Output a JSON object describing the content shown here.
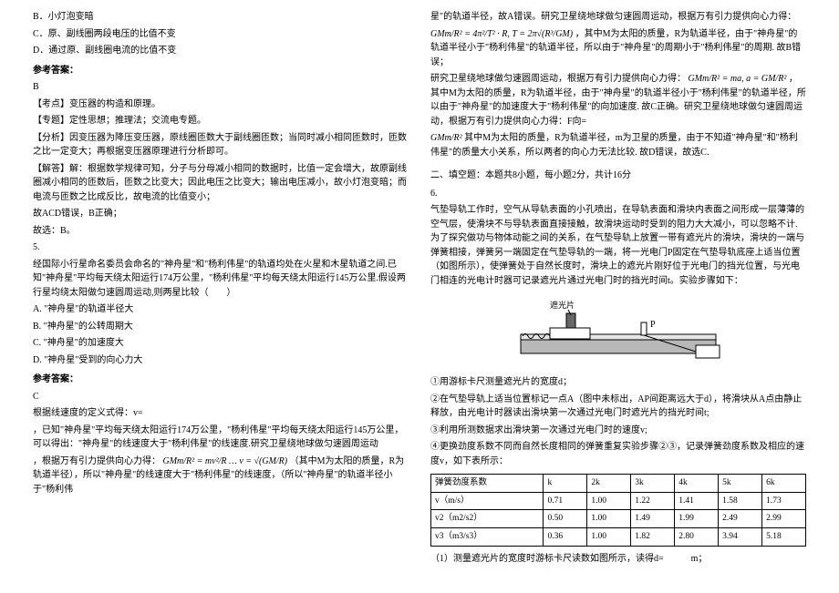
{
  "left": {
    "optB": "B．小灯泡变暗",
    "optC": "C．原、副线圈两段电压的比值不变",
    "optD": "D．通过原、副线圈电流的比值不变",
    "ansHead": "参考答案：",
    "ans": "B",
    "kd": "【考点】变压器的构造和原理。",
    "zt": "【专题】定性思想；推理法；交流电专题。",
    "fx": "【分析】因变压器为降压变压器，原线圈匝数大于副线圈匝数；当同时减小相同匝数时，匝数之比一定变大；再根据变压器原理进行分析即可。",
    "jdHead": "【解答】解：根据数学规律可知，分子与分母减小相同的数据时，比值一定会增大，故原副线圈减小相同的匝数后，匝数之比变大；因此电压之比变大；输出电压减小，故小灯泡变暗；而电流与匝数之比成反比，故电流的比值变小；",
    "jdRes": "故ACD错误，B正确；",
    "jdSel": "故选：B。",
    "q5num": "5.",
    "q5p1": "经国际小行星命名委员会命名的\"神舟星\"和\"杨利伟星\"的轨道均处在火星和木星轨道之间.已知\"神舟星\"平均每天绕太阳运行174万公里，\"杨利伟星\"平均每天绕太阳运行145万公里.假设两行星均绕太阳做匀速圆周运动,则两星比较（　　）",
    "q5A": "A. \"神舟星\"的轨道半径大",
    "q5B": "B. \"神舟星\"的公转周期大",
    "q5C": "C. \"神舟星\"的加速度大",
    "q5D": "D. \"神舟星\"受到的向心力大",
    "q5ansHead": "参考答案：",
    "q5ans": "C",
    "q5exp1": "根据线速度的定义式得：v=",
    "q5exp2": "，已知\"神舟星\"平均每天绕太阳运行174万公里，\"杨利伟星\"平均每天绕太阳运行145万公里，可以得出：\"神舟星\"的线速度大于\"杨利伟星\"的线速度.研究卫星绕地球做匀速圆周运动",
    "q5exp3": "，根据万有引力提供向心力得：",
    "q5exp4": "（其中M为太阳的质量，R为轨道半径），所以\"神舟星\"的线速度大于\"杨利伟星\"的线速度，（所以\"神舟星\"的轨道半径小于\"杨利伟"
  },
  "right": {
    "p1": "星\"的轨道半径，故A错误。研究卫星绕地球做匀速圆周运动，根据万有引力提供向心力得：",
    "p2": "，其中M为太阳的质量，R为轨道半径，由于\"神舟星\"的轨道半径小于\"杨利伟星\"的轨道半径，所以由于\"神舟星\"的周期小于\"杨利伟星\"的周期. 故B错误；",
    "p3": "研究卫星绕地球做匀速圆周运动，根据万有引力提供向心力得：",
    "p3b": "，其中M为太阳的质量，R为轨道半径，由于\"神舟星\"的轨道半径小于\"杨利伟星\"的轨道半径，所以由于\"神舟星\"的加速度大于\"杨利伟星\"的向加速度. 故C正确。研究卫星绕地球做匀速圆周运动，根据万有引力提供向心力得：F向=",
    "p4": "其中M为太阳的质量，R为轨道半径，m为卫星的质量，由于不知道\"神舟星\"和\"杨利伟星\"的质量大小关系，所以两者的向心力无法比较. 故D错误，故选C.",
    "section2": "二、填空题：本题共8小题，每小题2分，共计16分",
    "q6num": "6.",
    "q6text": "气垫导轨工作时，空气从导轨表面的小孔喷出，在导轨表面和滑块内表面之间形成一层薄薄的空气层，使滑块不与导轨表面直接接触，故滑块运动时受到的阻力大大减小，可以忽略不计.为了探究做功与物体动能之间的关系，在气垫导轨上放置一带有遮光片的滑块，滑块的一端与弹簧相接，弹簧另一端固定在气垫导轨的一端，将一光电门P固定在气垫导轨底座上适当位置（如图所示），使弹簧处于自然长度时，滑块上的遮光片刚好位于光电门的挡光位置，与光电门相连的光电计时器可记录遮光片通过光电门时的挡光时间t。实验步骤如下：",
    "diagLabel1": "遮光片",
    "diagLabelP": "P",
    "step1": "①用游标卡尺测量遮光片的宽度d；",
    "step2": "②在气垫导轨上适当位置标记一点A（图中未标出，AP间距离远大于d），将滑块从A点由静止释放，由光电计时器读出滑块第一次通过光电门时遮光片的挡光时间t;",
    "step3": "③利用所测数据求出滑块第一次通过光电门时的速度v;",
    "step4": "④更换劲度系数不同而自然长度相同的弹簧重复实验步骤②③，记录弹簧劲度系数及相应的速度v，如下表所示：",
    "q6q1": "（1）测量遮光片的宽度时游标卡尺读数如图所示，读得d=　　　m；"
  },
  "table": {
    "h0": "弹簧劲度系数",
    "h1": "k",
    "h2": "2k",
    "h3": "3k",
    "h4": "4k",
    "h5": "5k",
    "h6": "6k",
    "r1_0": "v（m/s）",
    "r1_1": "0.71",
    "r1_2": "1.00",
    "r1_3": "1.22",
    "r1_4": "1.41",
    "r1_5": "1.58",
    "r1_6": "1.73",
    "r2_0": "v2（m2/s2）",
    "r2_1": "0.50",
    "r2_2": "1.00",
    "r2_3": "1.49",
    "r2_4": "1.99",
    "r2_5": "2.49",
    "r2_6": "2.99",
    "r3_0": "v3（m3/s3）",
    "r3_1": "0.36",
    "r3_2": "1.00",
    "r3_3": "1.82",
    "r3_4": "2.80",
    "r3_5": "3.94",
    "r3_6": "5.18"
  }
}
